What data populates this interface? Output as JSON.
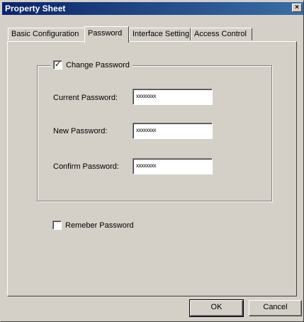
{
  "window": {
    "title": "Property Sheet",
    "close_symbol": "×"
  },
  "tabs": [
    {
      "label": "Basic Configuration",
      "active": false
    },
    {
      "label": "Password",
      "active": true
    },
    {
      "label": "Interface Setting",
      "active": false
    },
    {
      "label": "Access Control",
      "active": false
    }
  ],
  "password_group": {
    "change_password": {
      "label": "Change Password",
      "checked": true,
      "check_symbol": "✓"
    },
    "current_password": {
      "label": "Current Password:",
      "value": "xxxxxxxx"
    },
    "new_password": {
      "label": "New Password:",
      "value": "xxxxxxxx"
    },
    "confirm_password": {
      "label": "Confirm Password:",
      "value": "xxxxxxxx"
    }
  },
  "remember_password": {
    "label": "Remeber Password",
    "checked": false
  },
  "buttons": {
    "ok": "OK",
    "cancel": "Cancel"
  }
}
